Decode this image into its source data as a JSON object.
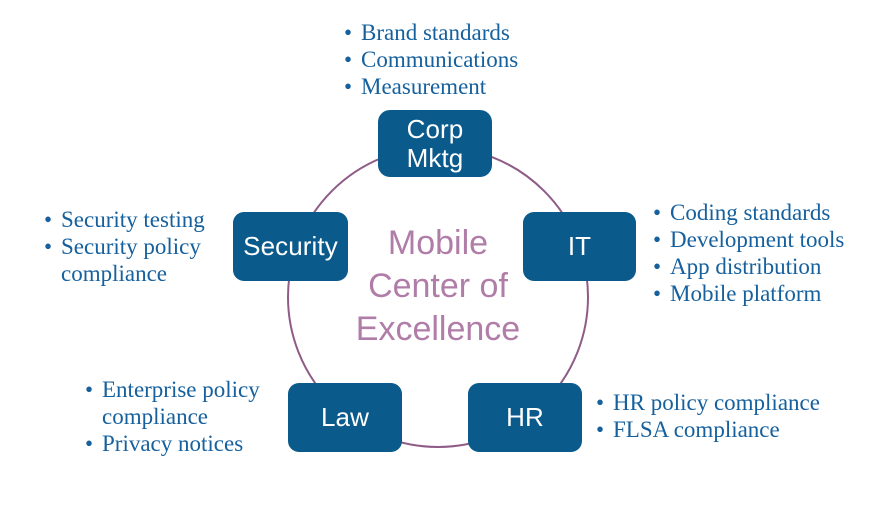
{
  "diagram": {
    "title": "Mobile Center of Excellence",
    "center_label": "Mobile\nCenter of\nExcellence",
    "colors": {
      "node_fill": "#0A5A8C",
      "node_text": "#FFFFFF",
      "center_text": "#B07DA8",
      "ring_stroke": "#8E5C87",
      "bullet_text": "#15609D",
      "background": "#FFFFFF"
    },
    "nodes": [
      {
        "id": "corp-mktg",
        "label": "Corp\nMktg",
        "position": "top",
        "bullets": [
          "Brand standards",
          "Communications",
          "Measurement"
        ]
      },
      {
        "id": "it",
        "label": "IT",
        "position": "right",
        "bullets": [
          "Coding standards",
          "Development tools",
          "App distribution",
          "Mobile platform"
        ]
      },
      {
        "id": "security",
        "label": "Security",
        "position": "left",
        "bullets": [
          "Security testing",
          "Security policy\ncompliance"
        ]
      },
      {
        "id": "law",
        "label": "Law",
        "position": "bottom-left",
        "bullets": [
          "Enterprise policy\ncompliance",
          "Privacy notices"
        ]
      },
      {
        "id": "hr",
        "label": "HR",
        "position": "bottom-right",
        "bullets": [
          "HR policy compliance",
          "FLSA compliance"
        ]
      }
    ]
  }
}
